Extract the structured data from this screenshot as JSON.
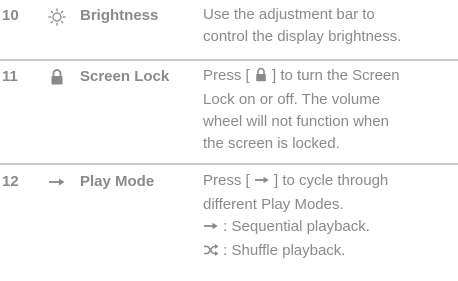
{
  "rows": [
    {
      "number": "10",
      "icon": "brightness-icon",
      "name": "Brightness",
      "lines": [
        "Use the adjustment bar to",
        "control the display brightness."
      ]
    },
    {
      "number": "11",
      "icon": "lock-icon",
      "name": "Screen Lock",
      "line1_pre": "Press [ ",
      "line1_post": " ] to turn the Screen",
      "lines": [
        "Lock on or off. The volume",
        "wheel will not function when",
        "the screen is locked."
      ]
    },
    {
      "number": "12",
      "icon": "arrow-right-icon",
      "name": "Play Mode",
      "line1_pre": "Press [ ",
      "line1_post": " ] to cycle through",
      "line2": "different Play Modes.",
      "sequential": ": Sequential playback.",
      "shuffle": ": Shuffle playback."
    }
  ],
  "colors": {
    "text": "#8a8a8a",
    "divider": "#c9c9c9",
    "background": "#ffffff"
  }
}
